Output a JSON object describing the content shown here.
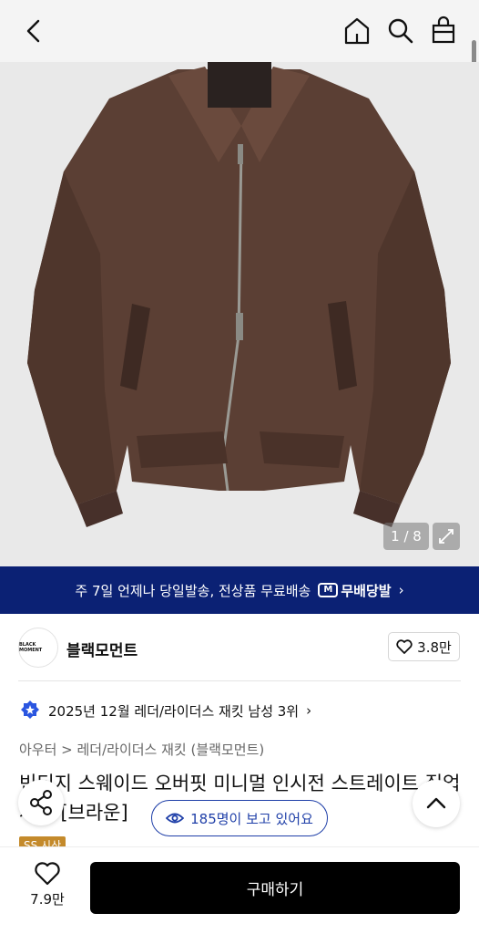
{
  "header": {
    "icons": [
      "back-icon",
      "home-icon",
      "search-icon",
      "shopping-bag-icon"
    ]
  },
  "gallery": {
    "counter": "1 / 8",
    "image_description_icon": "jacket-photo"
  },
  "banner": {
    "message": "주 7일 언제나 당일발송, 전상품 무료배송",
    "logo_mark": "M",
    "logo_text": "무배당발",
    "chevron": "›"
  },
  "brand": {
    "logo_text": "BLACK MOMENT",
    "name": "블랙모먼트",
    "likes": "3.8만"
  },
  "ranking": {
    "text": "2025년 12월 레더/라이더스 재킷 남성 3위",
    "chevron": "›"
  },
  "category": {
    "path": "아우터 > 레더/라이더스 재킷 (블랙모먼트)"
  },
  "product": {
    "title_line1": "빈티지 스웨이드 오버핏 미니멀 인시전 스트레이트 집업",
    "title_line2": "재킷 [브라운]",
    "tag": "SS 시산"
  },
  "viewers": {
    "text": "185명이 보고 있어요"
  },
  "bottom": {
    "wish_count": "7.9만",
    "buy_label": "구매하기"
  },
  "colors": {
    "banner_bg": "#0b2174",
    "accent_blue": "#1f3fa8",
    "buy_bg": "#000000",
    "jacket": "#5a3e33"
  }
}
